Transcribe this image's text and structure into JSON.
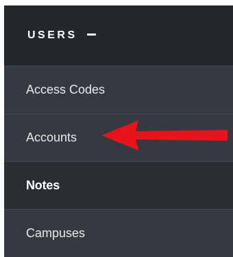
{
  "sidebar": {
    "section_title": "USERS",
    "collapse_icon": "minus-icon",
    "items": [
      {
        "label": "Access Codes",
        "active": false
      },
      {
        "label": "Accounts",
        "active": false
      },
      {
        "label": "Notes",
        "active": true
      },
      {
        "label": "Campuses",
        "active": false
      }
    ]
  },
  "annotation": {
    "icon": "red-arrow-icon",
    "color": "#e8131b",
    "points_to": "Accounts"
  }
}
